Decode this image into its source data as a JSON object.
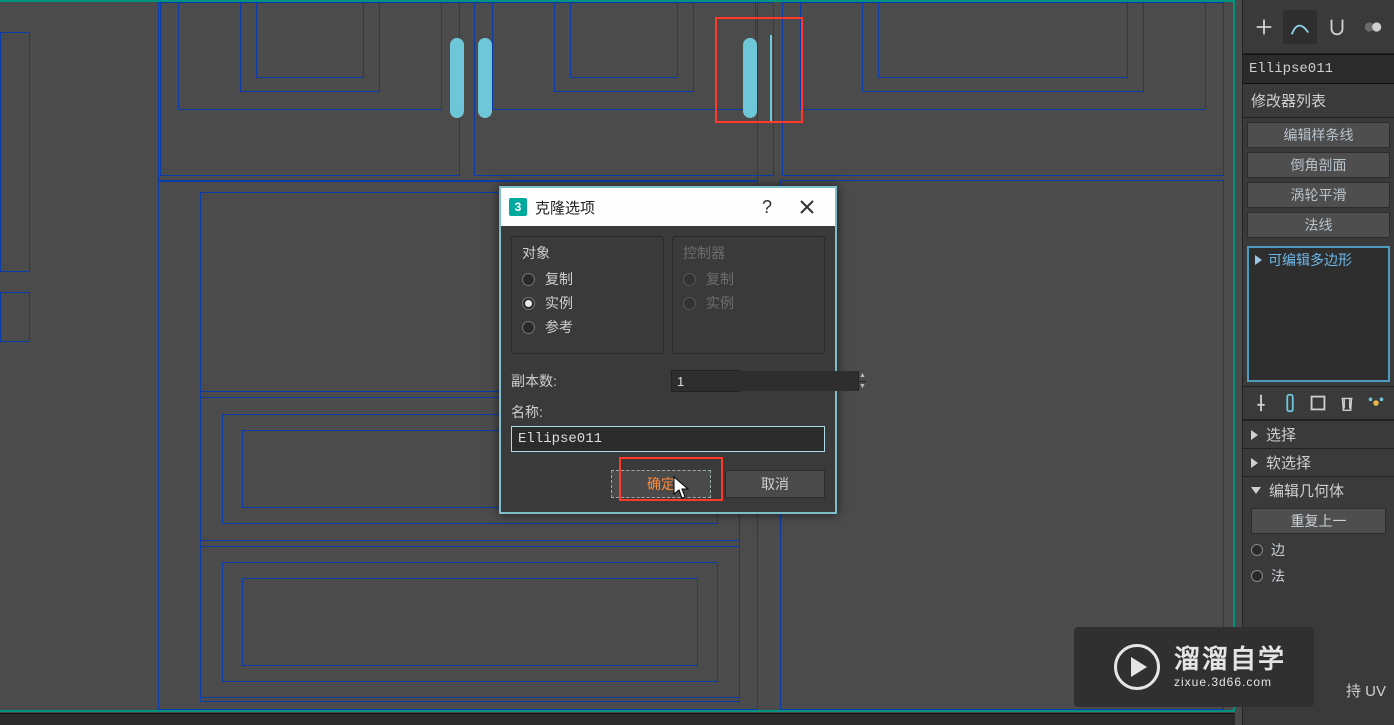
{
  "dialog": {
    "icon_label": "3",
    "title": "克隆选项",
    "object_group": "对象",
    "controller_group": "控制器",
    "opt_copy": "复制",
    "opt_instance": "实例",
    "opt_reference": "参考",
    "copies_label": "副本数:",
    "copies_value": "1",
    "name_label": "名称:",
    "name_value": "Ellipse011",
    "ok": "确定",
    "cancel": "取消",
    "object_selected": "instance"
  },
  "side": {
    "object_name": "Ellipse011",
    "modifier_list_label": "修改器列表",
    "mod_buttons": [
      "编辑样条线",
      "倒角剖面",
      "涡轮平滑",
      "法线"
    ],
    "stack_item": "可编辑多边形",
    "rollouts": {
      "select": "选择",
      "soft_select": "软选择",
      "edit_geom": "编辑几何体"
    },
    "repeat_last": "重复上一",
    "edge_opt": "边",
    "normal_opt": "法",
    "uv_label": "持 UV"
  },
  "watermark": {
    "big": "溜溜自学",
    "small": "zixue.3d66.com"
  },
  "icons": {
    "plus": "plus-icon",
    "curve": "curve-icon",
    "magnet": "magnet-icon",
    "toggle": "toggle-icon",
    "pin": "pin-icon",
    "pipe": "pipe-icon",
    "config": "config-icon",
    "trash": "trash-icon"
  }
}
